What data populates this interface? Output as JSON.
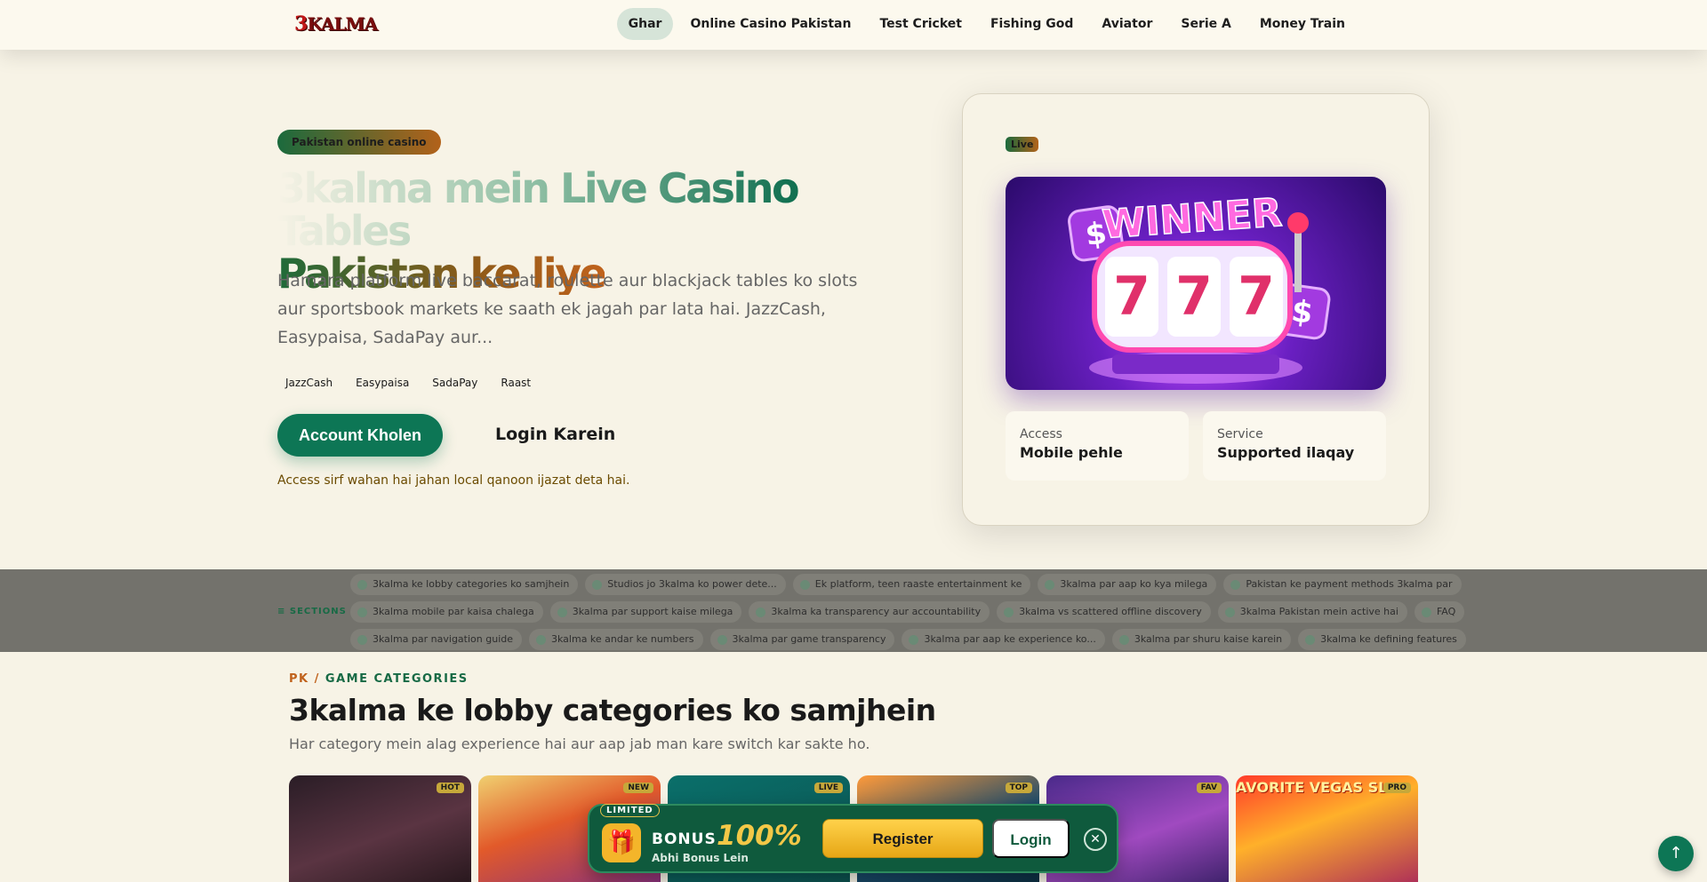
{
  "header": {
    "logo_text": "3KALMA",
    "nav": [
      {
        "label": "Ghar",
        "active": true
      },
      {
        "label": "Online Casino Pakistan",
        "active": false
      },
      {
        "label": "Test Cricket",
        "active": false
      },
      {
        "label": "Fishing God",
        "active": false
      },
      {
        "label": "Aviator",
        "active": false
      },
      {
        "label": "Serie A",
        "active": false
      },
      {
        "label": "Money Train",
        "active": false
      }
    ]
  },
  "hero": {
    "tag": "Pakistan online casino",
    "title_line1": "3kalma mein Live Casino Tables",
    "title_line2": "Pakistan ke liye",
    "description": "Hamara platform live baccarat, roulette aur blackjack tables ko slots aur sportsbook markets ke saath ek jagah par lata hai. JazzCash, Easypaisa, SadaPay aur...",
    "payments": [
      "JazzCash",
      "Easypaisa",
      "SadaPay",
      "Raast"
    ],
    "cta_primary": "Account Kholen",
    "cta_secondary": "Login Karein",
    "disclaimer": "Access sirf wahan hai jahan local qanoon ijazat deta hai."
  },
  "hero_card": {
    "badge": "Live",
    "image_caption": "WINNER",
    "stats": [
      {
        "key": "Access",
        "value": "Mobile pehle"
      },
      {
        "key": "Service",
        "value": "Supported ilaqay"
      }
    ]
  },
  "sections": {
    "label": "≡ SECTIONS",
    "row1": [
      "3kalma ke lobby categories ko samjhein",
      "Studios jo 3kalma ko power dete...",
      "Ek platform, teen raaste entertainment ke",
      "3kalma par aap ko kya milega",
      "Pakistan ke payment methods 3kalma par"
    ],
    "row2": [
      "3kalma mobile par kaisa chalega",
      "3kalma par support kaise milega",
      "3kalma ka transparency aur accountability",
      "3kalma vs scattered offline discovery",
      "3kalma Pakistan mein active hai",
      "FAQ"
    ],
    "row3": [
      "3kalma par navigation guide",
      "3kalma ke andar ke numbers",
      "3kalma par game transparency",
      "3kalma par aap ke experience ko...",
      "3kalma par shuru kaise karein",
      "3kalma ke defining features"
    ]
  },
  "categories": {
    "crumb_pk": "PK",
    "crumb_sep": " / ",
    "crumb_label": "GAME CATEGORIES",
    "title": "3kalma ke lobby categories ko samjhein",
    "subtitle": "Har category mein alag experience hai aur aap jab man kare switch kar sakte ho.",
    "games": [
      {
        "badge": "HOT"
      },
      {
        "badge": "NEW"
      },
      {
        "badge": "LIVE"
      },
      {
        "badge": "TOP"
      },
      {
        "badge": "FAV"
      },
      {
        "badge": "PRO",
        "art_text": "AVORITE VEGAS SL"
      }
    ]
  },
  "bonus_bar": {
    "limited": "LIMITED",
    "bonus_word": "BONUS",
    "bonus_pct": "100%",
    "bonus_sub": "Abhi Bonus Lein",
    "register": "Register",
    "login": "Login"
  },
  "colors": {
    "primary_green": "#0d7655",
    "accent_orange": "#c0621c",
    "background": "#f7f3e6",
    "bonus_gold": "#f3c847"
  }
}
